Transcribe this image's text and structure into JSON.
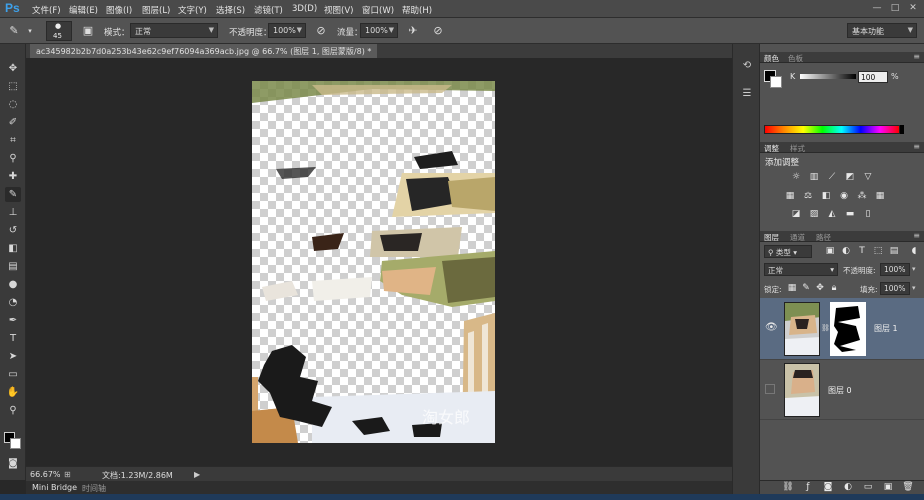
{
  "app": {
    "logo": "Ps"
  },
  "menu": [
    "文件(F)",
    "编辑(E)",
    "图像(I)",
    "图层(L)",
    "文字(Y)",
    "选择(S)",
    "滤镜(T)",
    "3D(D)",
    "视图(V)",
    "窗口(W)",
    "帮助(H)"
  ],
  "window_controls": [
    "—",
    "□",
    "✕"
  ],
  "options": {
    "brush_size": "45",
    "mode_label": "模式：",
    "mode_value": "正常",
    "opacity_label": "不透明度：",
    "opacity_value": "100%",
    "flow_label": "流量：",
    "flow_value": "100%",
    "workspace": "基本功能"
  },
  "document": {
    "tab_title": "ac345982b2b7d0a253b43e62c9ef76094a369acb.jpg @ 66.7% (图层 1, 图层蒙版/8) *",
    "tab_close": "×"
  },
  "status": {
    "zoom": "66.67%",
    "doc_info": "文档:1.23M/2.86M"
  },
  "bottom_tabs": [
    "Mini Bridge",
    "时间轴"
  ],
  "color_panel": {
    "tabs": [
      "颜色",
      "色板"
    ],
    "channel": "K",
    "value": "100",
    "unit": "%"
  },
  "adjustments_panel": {
    "tabs": [
      "调整",
      "样式"
    ],
    "title": "添加调整"
  },
  "layers_panel": {
    "tabs": [
      "图层",
      "通道",
      "路径"
    ],
    "kind_label": "类型",
    "blend_mode": "正常",
    "opacity_label": "不透明度:",
    "opacity_value": "100%",
    "lock_label": "锁定:",
    "fill_label": "填充:",
    "fill_value": "100%",
    "layers": [
      {
        "name": "图层 1",
        "visible": true,
        "selected": true,
        "has_mask": true
      },
      {
        "name": "图层 0",
        "visible": false,
        "selected": false,
        "has_mask": false
      }
    ]
  },
  "watermark_text": "淘女郎",
  "colors": {
    "accent": "#3ea1ea",
    "selected_layer": "#5a6b82"
  }
}
